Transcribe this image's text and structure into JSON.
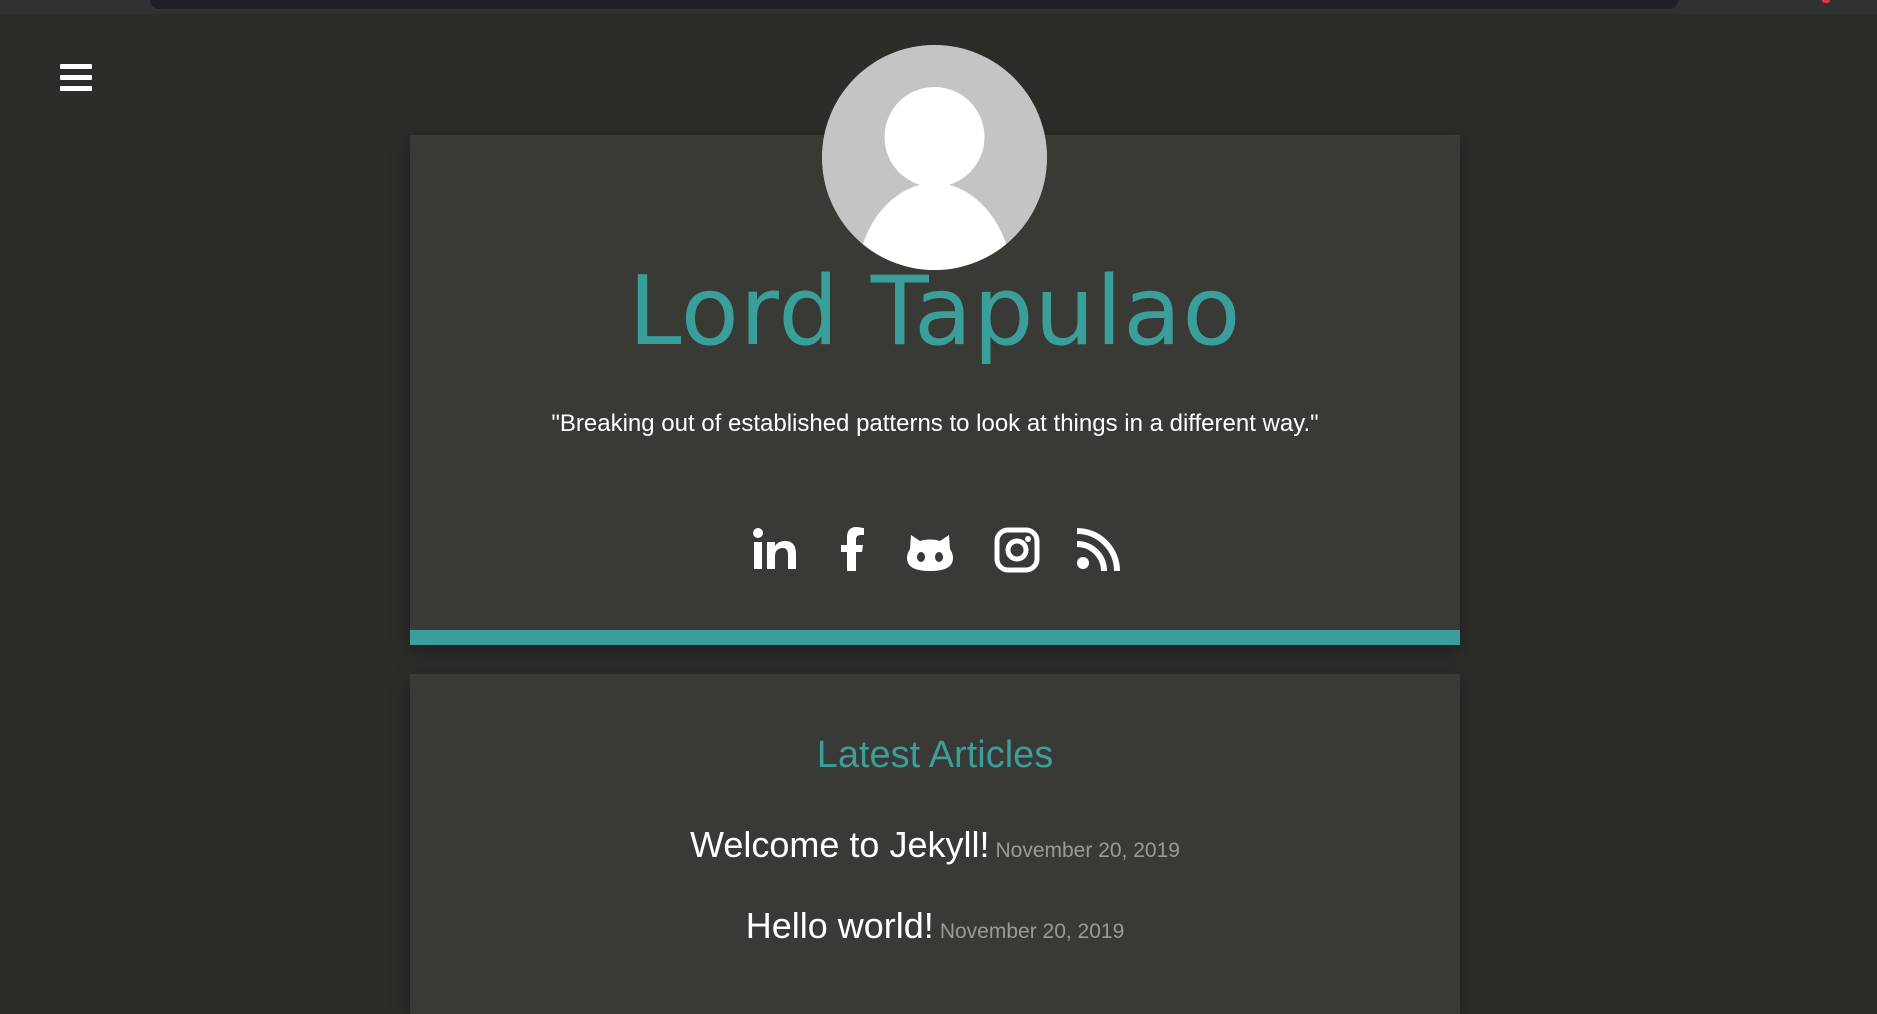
{
  "site": {
    "title": "Lord Tapulao",
    "tagline": "\"Breaking out of established patterns to look at things in a different way.\""
  },
  "social_links": [
    {
      "icon": "linkedin-icon",
      "label": "LinkedIn"
    },
    {
      "icon": "facebook-icon",
      "label": "Facebook"
    },
    {
      "icon": "github-icon",
      "label": "GitHub"
    },
    {
      "icon": "instagram-icon",
      "label": "Instagram"
    },
    {
      "icon": "rss-icon",
      "label": "RSS"
    }
  ],
  "articles": {
    "heading": "Latest Articles",
    "items": [
      {
        "title": "Welcome to Jekyll!",
        "date": "November 20, 2019"
      },
      {
        "title": "Hello world!",
        "date": "November 20, 2019"
      }
    ]
  },
  "colors": {
    "accent": "#3a9e9b",
    "background": "#2c2c29",
    "card": "#393935",
    "text": "#ffffff",
    "muted": "#9a9a96"
  }
}
